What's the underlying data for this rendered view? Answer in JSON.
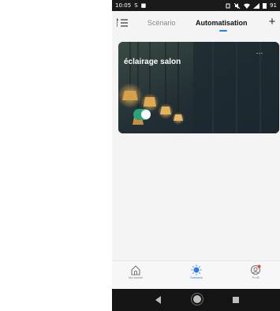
{
  "status_bar": {
    "time": "10:05",
    "left_icons": [
      "S",
      "■"
    ],
    "right_text": "91"
  },
  "top_nav": {
    "tabs": [
      {
        "label": "Scénario",
        "active": false
      },
      {
        "label": "Automatisation",
        "active": true
      }
    ],
    "add_label": "+"
  },
  "automation_card": {
    "title": "éclairage salon",
    "more_label": "···",
    "enabled": true,
    "accent_color": "#2aa37a"
  },
  "bottom_nav": {
    "items": [
      {
        "label": "Ma famille",
        "icon": "home-icon",
        "active": false
      },
      {
        "label": "Scénario",
        "icon": "sun-icon",
        "active": true
      },
      {
        "label": "Profil",
        "icon": "profile-icon",
        "active": false
      }
    ]
  },
  "colors": {
    "accent": "#2b7de9",
    "toggle_on": "#2aa37a"
  }
}
